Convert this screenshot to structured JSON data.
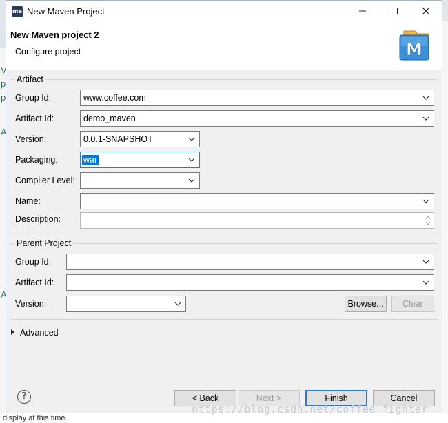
{
  "window": {
    "title": "New Maven Project",
    "app_icon": "me",
    "minimize": "—",
    "maximize": "☐",
    "close": "✕"
  },
  "header": {
    "title": "New Maven project 2",
    "subtitle": "Configure project",
    "logo_letter": "M"
  },
  "artifact": {
    "legend": "Artifact",
    "group_id": {
      "label": "Group Id:",
      "value": "www.coffee.com"
    },
    "artifact_id": {
      "label": "Artifact Id:",
      "value": "demo_maven"
    },
    "version": {
      "label": "Version:",
      "value": "0.0.1-SNAPSHOT"
    },
    "packaging": {
      "label": "Packaging:",
      "value": "war"
    },
    "compiler_level": {
      "label": "Compiler Level:",
      "value": ""
    },
    "name": {
      "label": "Name:",
      "value": ""
    },
    "description": {
      "label": "Description:",
      "value": ""
    }
  },
  "parent": {
    "legend": "Parent Project",
    "group_id": {
      "label": "Group Id:",
      "value": ""
    },
    "artifact_id": {
      "label": "Artifact Id:",
      "value": ""
    },
    "version": {
      "label": "Version:",
      "value": ""
    },
    "browse_label": "Browse...",
    "clear_label": "Clear"
  },
  "advanced": {
    "label": "Advanced"
  },
  "footer": {
    "help_symbol": "?",
    "back_label": "< Back",
    "next_label": "Next >",
    "finish_label": "Finish",
    "cancel_label": "Cancel"
  },
  "background": {
    "bottom_text": "display at this time.",
    "watermark": "https://blog.csdn.net/coffee_fighter"
  },
  "colors": {
    "accent": "#0078d7",
    "focus_border": "#2a7bd6",
    "dialog_bg": "#f0f0f0"
  }
}
